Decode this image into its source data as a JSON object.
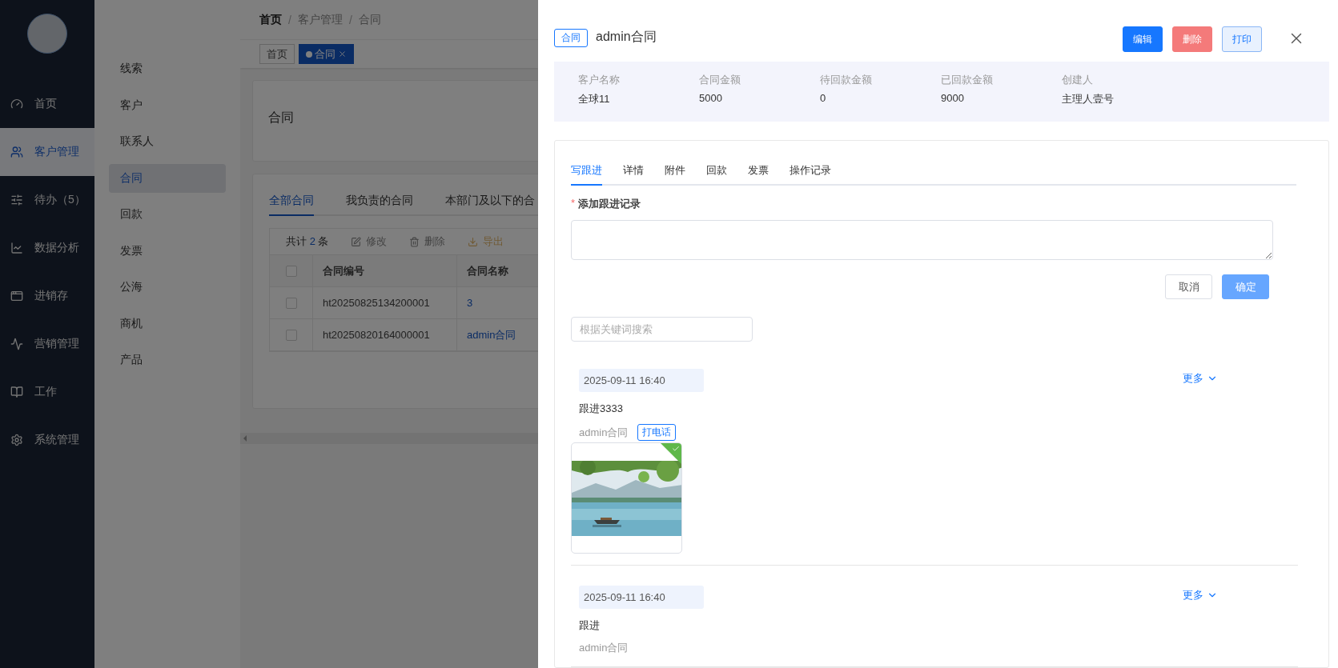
{
  "sidebar": {
    "items": [
      {
        "label": "首页",
        "selected": false
      },
      {
        "label": "客户管理",
        "selected": true
      },
      {
        "label": "待办（5）",
        "selected": false
      },
      {
        "label": "数据分析",
        "selected": false
      },
      {
        "label": "进销存",
        "selected": false
      },
      {
        "label": "营销管理",
        "selected": false
      },
      {
        "label": "工作",
        "selected": false
      },
      {
        "label": "系统管理",
        "selected": false
      }
    ]
  },
  "submenu": {
    "items": [
      {
        "label": "线索",
        "selected": false
      },
      {
        "label": "客户",
        "selected": false
      },
      {
        "label": "联系人",
        "selected": false
      },
      {
        "label": "合同",
        "selected": true
      },
      {
        "label": "回款",
        "selected": false
      },
      {
        "label": "发票",
        "selected": false
      },
      {
        "label": "公海",
        "selected": false
      },
      {
        "label": "商机",
        "selected": false
      },
      {
        "label": "产品",
        "selected": false
      }
    ]
  },
  "breadcrumb": [
    "首页",
    "客户管理",
    "合同"
  ],
  "breadcrumb_separator": "/",
  "page_tabs": [
    {
      "label": "首页",
      "selected": false
    },
    {
      "label": "合同",
      "selected": true
    }
  ],
  "page_title": "合同",
  "list_tabs": [
    {
      "label": "全部合同",
      "selected": true
    },
    {
      "label": "我负责的合同",
      "selected": false
    },
    {
      "label": "本部门及以下的合",
      "selected": false
    }
  ],
  "toolbar": {
    "total_prefix": "共计",
    "total": "2",
    "total_suffix": "条",
    "actions": [
      {
        "kind": "edit",
        "label": "修改"
      },
      {
        "kind": "delete",
        "label": "删除"
      },
      {
        "kind": "export",
        "label": "导出"
      }
    ]
  },
  "table": {
    "header_checked": false,
    "columns": [
      "合同编号",
      "合同名称"
    ],
    "rows": [
      {
        "checked": false,
        "number": "ht20250825134200001",
        "name": "3"
      },
      {
        "checked": false,
        "number": "ht20250820164000001",
        "name": "admin合同"
      }
    ]
  },
  "drawer": {
    "tag": "合同",
    "title": "admin合同",
    "buttons": [
      {
        "kind": "primary",
        "label": "编辑"
      },
      {
        "kind": "danger",
        "label": "删除"
      },
      {
        "kind": "plain",
        "label": "打印"
      }
    ],
    "summary": [
      {
        "label": "客户名称",
        "value": "全球11"
      },
      {
        "label": "合同金额",
        "value": "5000"
      },
      {
        "label": "待回款金额",
        "value": "0"
      },
      {
        "label": "已回款金额",
        "value": "9000"
      },
      {
        "label": "创建人",
        "value": "主理人壹号"
      }
    ],
    "tabs": [
      {
        "label": "写跟进",
        "selected": true
      },
      {
        "label": "详情",
        "selected": false
      },
      {
        "label": "附件",
        "selected": false
      },
      {
        "label": "回款",
        "selected": false
      },
      {
        "label": "发票",
        "selected": false
      },
      {
        "label": "操作记录",
        "selected": false
      }
    ],
    "form": {
      "required_mark": "*",
      "label": "添加跟进记录",
      "cancel": "取消",
      "confirm": "确定"
    },
    "search": {
      "placeholder": "根据关键词搜索"
    },
    "records": [
      {
        "time": "2025-09-11 16:40",
        "more": "更多",
        "text": "跟进3333",
        "author": "admin合同",
        "tag": "打电话"
      },
      {
        "time": "2025-09-11 16:40",
        "more": "更多",
        "text": "跟进",
        "author": "admin合同"
      }
    ]
  }
}
